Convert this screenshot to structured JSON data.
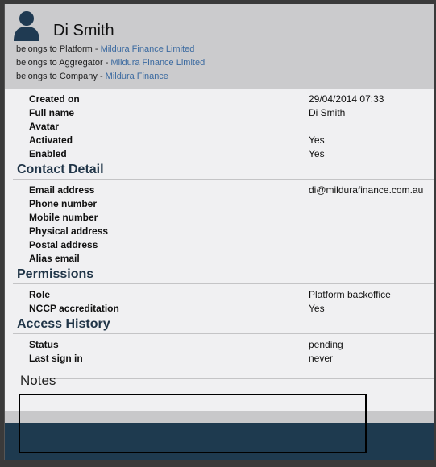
{
  "user": {
    "name": "Di Smith",
    "belongs": [
      {
        "prefix": "belongs to Platform - ",
        "link": "Mildura Finance Limited"
      },
      {
        "prefix": "belongs to Aggregator - ",
        "link": "Mildura Finance Limited"
      },
      {
        "prefix": "belongs to Company - ",
        "link": "Mildura Finance"
      }
    ]
  },
  "details": [
    {
      "label": "Created on",
      "value": "29/04/2014 07:33"
    },
    {
      "label": "Full name",
      "value": "Di Smith"
    },
    {
      "label": "Avatar",
      "value": ""
    },
    {
      "label": "Activated",
      "value": "Yes"
    },
    {
      "label": "Enabled",
      "value": "Yes"
    }
  ],
  "contact": {
    "title": "Contact Detail",
    "rows": [
      {
        "label": "Email address",
        "value": "di@mildurafinance.com.au"
      },
      {
        "label": "Phone number",
        "value": ""
      },
      {
        "label": "Mobile number",
        "value": ""
      },
      {
        "label": "Physical address",
        "value": ""
      },
      {
        "label": "Postal address",
        "value": ""
      },
      {
        "label": "Alias email",
        "value": ""
      }
    ]
  },
  "permissions": {
    "title": "Permissions",
    "rows": [
      {
        "label": "Role",
        "value": "Platform backoffice"
      },
      {
        "label": "NCCP accreditation",
        "value": "Yes"
      }
    ]
  },
  "access": {
    "title": "Access History",
    "rows": [
      {
        "label": "Status",
        "value": "pending"
      },
      {
        "label": "Last sign in",
        "value": "never"
      }
    ]
  },
  "notes": {
    "title": "Notes"
  },
  "colors": {
    "header": "#cbcbcd",
    "accent_link": "#3b6aa0",
    "footer": "#1e3a4f"
  }
}
